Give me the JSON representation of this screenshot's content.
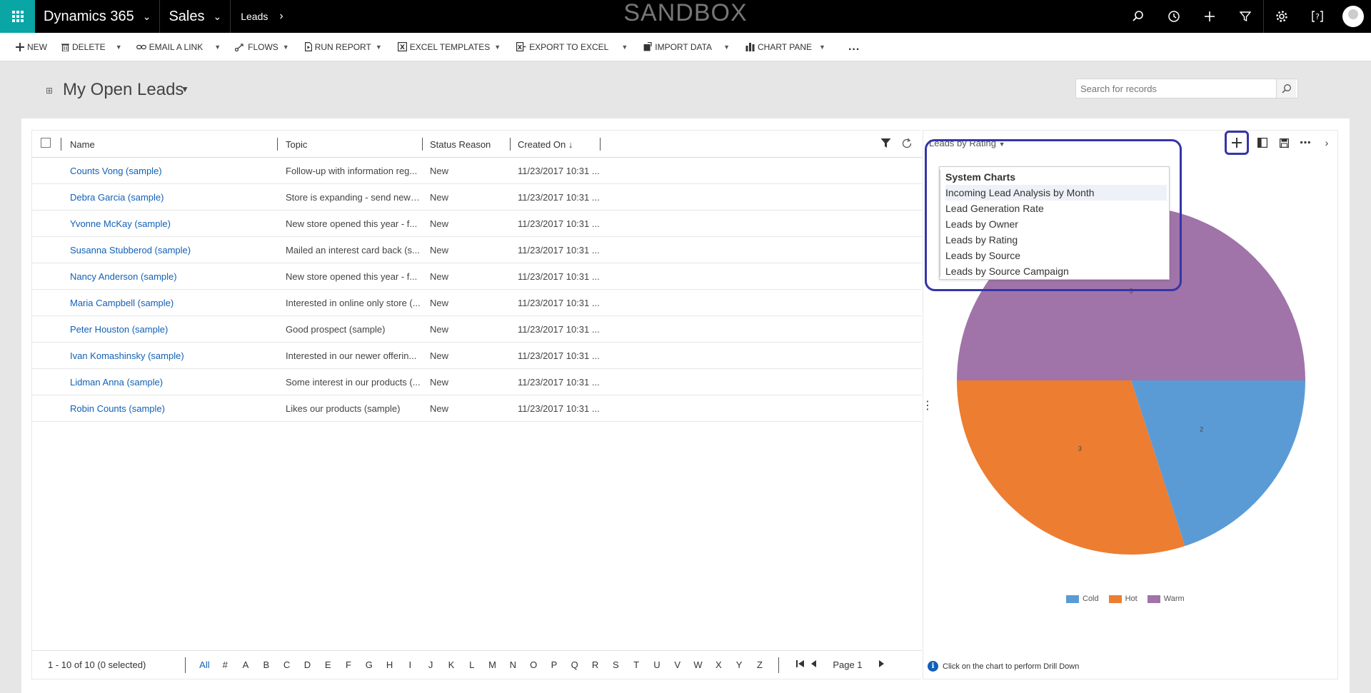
{
  "topnav": {
    "app_name": "Dynamics 365",
    "area": "Sales",
    "entity": "Leads",
    "watermark": "SANDBOX",
    "icons": [
      "search-icon",
      "recent-icon",
      "new-icon",
      "filter-icon",
      "settings-icon",
      "help-icon",
      "user-avatar"
    ]
  },
  "commands": {
    "new": "NEW",
    "delete": "DELETE",
    "email_link": "EMAIL A LINK",
    "flows": "FLOWS",
    "run_report": "RUN REPORT",
    "excel_templates": "EXCEL TEMPLATES",
    "export_excel": "EXPORT TO EXCEL",
    "import_data": "IMPORT DATA",
    "chart_pane": "CHART PANE",
    "more": "..."
  },
  "view": {
    "title": "My Open Leads",
    "search_placeholder": "Search for records"
  },
  "grid": {
    "headers": {
      "name": "Name",
      "topic": "Topic",
      "status": "Status Reason",
      "created": "Created On ↓"
    },
    "rows": [
      {
        "name": "Counts Vong (sample)",
        "topic": "Follow-up with information reg...",
        "status": "New",
        "created": "11/23/2017 10:31 ..."
      },
      {
        "name": "Debra Garcia (sample)",
        "topic": "Store is expanding - send new l...",
        "status": "New",
        "created": "11/23/2017 10:31 ..."
      },
      {
        "name": "Yvonne McKay (sample)",
        "topic": "New store opened this year - f...",
        "status": "New",
        "created": "11/23/2017 10:31 ..."
      },
      {
        "name": "Susanna Stubberod (sample)",
        "topic": "Mailed an interest card back (s...",
        "status": "New",
        "created": "11/23/2017 10:31 ..."
      },
      {
        "name": "Nancy Anderson (sample)",
        "topic": "New store opened this year - f...",
        "status": "New",
        "created": "11/23/2017 10:31 ..."
      },
      {
        "name": "Maria Campbell (sample)",
        "topic": "Interested in online only store (...",
        "status": "New",
        "created": "11/23/2017 10:31 ..."
      },
      {
        "name": "Peter Houston (sample)",
        "topic": "Good prospect (sample)",
        "status": "New",
        "created": "11/23/2017 10:31 ..."
      },
      {
        "name": "Ivan Komashinsky (sample)",
        "topic": "Interested in our newer offerin...",
        "status": "New",
        "created": "11/23/2017 10:31 ..."
      },
      {
        "name": "Lidman Anna (sample)",
        "topic": "Some interest in our products (...",
        "status": "New",
        "created": "11/23/2017 10:31 ..."
      },
      {
        "name": "Robin Counts (sample)",
        "topic": "Likes our products (sample)",
        "status": "New",
        "created": "11/23/2017 10:31 ..."
      }
    ],
    "footer": {
      "record_count": "1 - 10 of 10 (0 selected)",
      "letters": [
        "All",
        "#",
        "A",
        "B",
        "C",
        "D",
        "E",
        "F",
        "G",
        "H",
        "I",
        "J",
        "K",
        "L",
        "M",
        "N",
        "O",
        "P",
        "Q",
        "R",
        "S",
        "T",
        "U",
        "V",
        "W",
        "X",
        "Y",
        "Z"
      ],
      "page": "Page 1"
    }
  },
  "chartpane": {
    "selected_chart": "Leads by Rating",
    "dropdown": {
      "header": "System Charts",
      "items": [
        "Incoming Lead Analysis by Month",
        "Lead Generation Rate",
        "Leads by Owner",
        "Leads by Rating",
        "Leads by Source",
        "Leads by Source Campaign"
      ]
    },
    "drill_hint": "Click on the chart to perform Drill Down"
  },
  "chart_data": {
    "type": "pie",
    "title": "",
    "categories": [
      "Cold",
      "Hot",
      "Warm"
    ],
    "values": [
      2,
      3,
      5
    ],
    "colors": [
      "#5b9bd5",
      "#ed7d31",
      "#a074a8"
    ],
    "legend_position": "bottom"
  }
}
